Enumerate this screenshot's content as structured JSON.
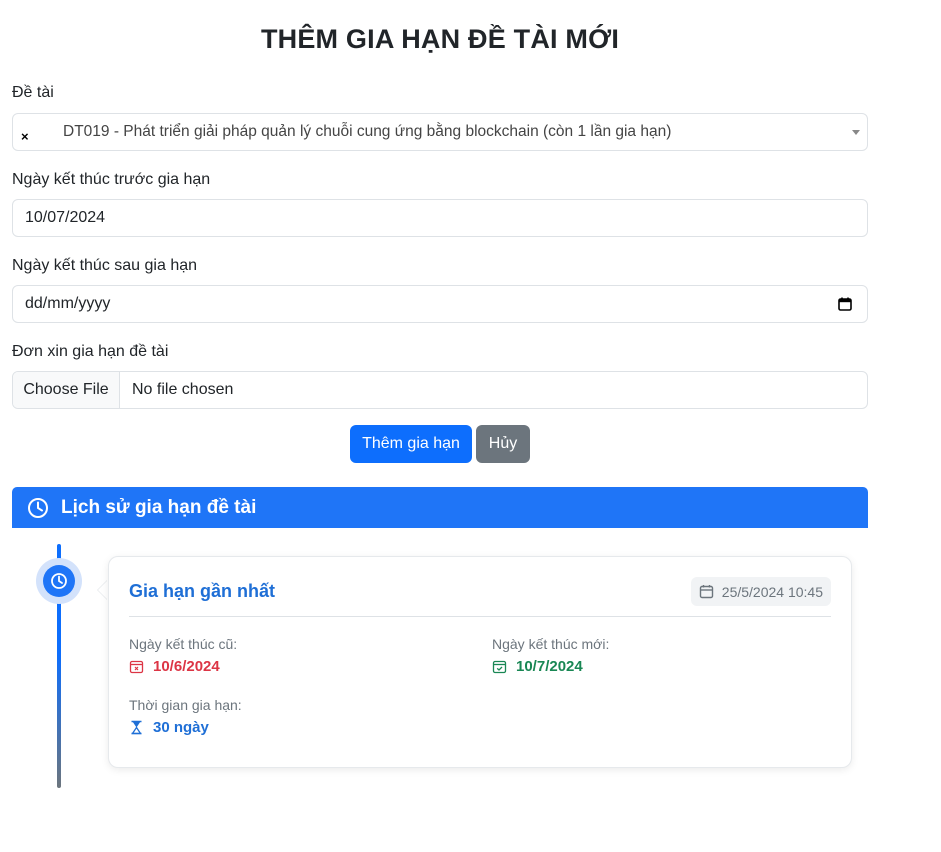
{
  "page": {
    "title": "THÊM GIA HẠN ĐỀ TÀI MỚI"
  },
  "form": {
    "topic_label": "Đề tài",
    "topic_clear": "×",
    "topic_value": "DT019 - Phát triển giải pháp quản lý chuỗi cung ứng bằng blockchain (còn 1 lần gia hạn)",
    "end_before_label": "Ngày kết thúc trước gia hạn",
    "end_before_value": "10/07/2024",
    "end_after_label": "Ngày kết thúc sau gia hạn",
    "end_after_placeholder": "dd/mm/yyyy",
    "request_label": "Đơn xin gia hạn đề tài",
    "choose_file": "Choose File",
    "no_file": "No file chosen",
    "submit_label": "Thêm gia hạn",
    "cancel_label": "Hủy"
  },
  "history": {
    "title": "Lịch sử gia hạn đề tài",
    "entry": {
      "title": "Gia hạn gần nhất",
      "timestamp": "25/5/2024 10:45",
      "old_end_label": "Ngày kết thúc cũ:",
      "old_end_value": "10/6/2024",
      "new_end_label": "Ngày kết thúc mới:",
      "new_end_value": "10/7/2024",
      "duration_label": "Thời gian gia hạn:",
      "duration_value": "30 ngày"
    }
  },
  "colors": {
    "primary": "#0d6efd",
    "secondary": "#6c757d",
    "danger": "#dc3545",
    "success": "#198754"
  },
  "icons": [
    "clock-icon",
    "calendar-icon",
    "calendar-x-icon",
    "calendar-check-icon",
    "hourglass-icon",
    "chevron-down-icon",
    "clear-icon"
  ]
}
